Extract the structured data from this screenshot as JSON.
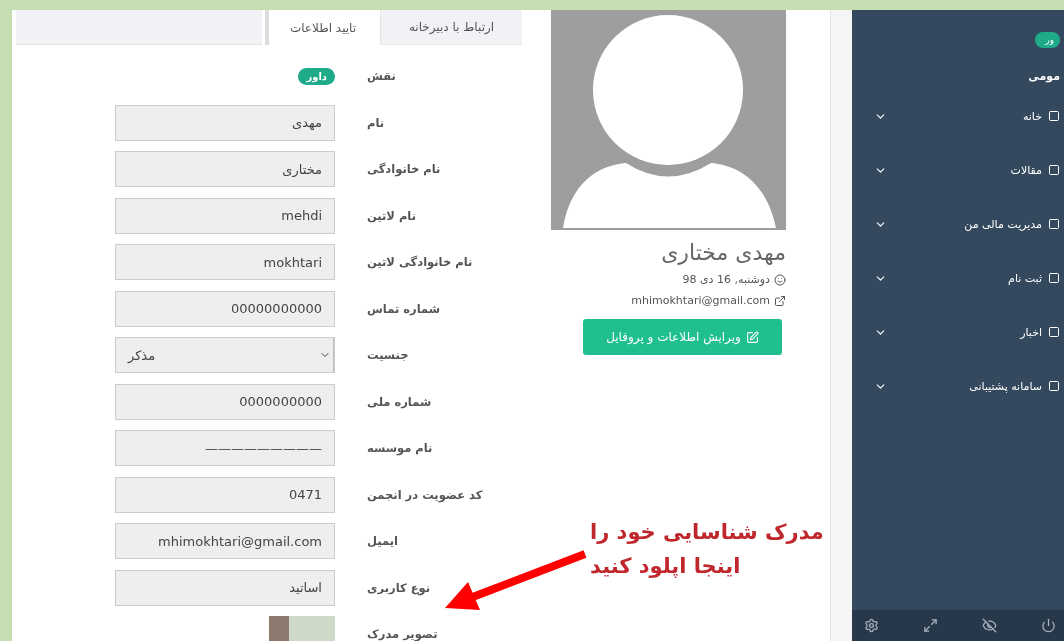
{
  "tabs": [
    {
      "label": "ارتباط با دبیرخانه",
      "selected": false
    },
    {
      "label": "تایید اطلاعات",
      "selected": true
    }
  ],
  "form": {
    "rows": [
      {
        "label": "نقش",
        "kind": "badge",
        "value": "داور"
      },
      {
        "label": "نام",
        "kind": "text",
        "value": "مهدی"
      },
      {
        "label": "نام خانوادگی",
        "kind": "text",
        "value": "مختاری"
      },
      {
        "label": "نام لاتین",
        "kind": "text",
        "value": "mehdi"
      },
      {
        "label": "نام خانوادگی لاتین",
        "kind": "text",
        "value": "mokhtari"
      },
      {
        "label": "شماره تماس",
        "kind": "text",
        "value": "00000000000"
      },
      {
        "label": "جنسیت",
        "kind": "select",
        "value": "مذکر"
      },
      {
        "label": "شماره ملی",
        "kind": "text",
        "value": "0000000000"
      },
      {
        "label": "نام موسسه",
        "kind": "text",
        "value": "—————————"
      },
      {
        "label": "کد عضویت در انجمن",
        "kind": "text",
        "value": "0471"
      },
      {
        "label": "ایمیل",
        "kind": "text",
        "value": "mhimokhtari@gmail.com"
      },
      {
        "label": "نوع کاربری",
        "kind": "text",
        "value": "اساتید"
      },
      {
        "label": "تصویر مدرک",
        "kind": "image"
      }
    ]
  },
  "profile": {
    "name": "مهدی مختاری",
    "date": "دوشنبه, 16 دی 98",
    "email": "mhimokhtari@gmail.com",
    "edit_button": "ویرایش اطلاعات و پروفایل"
  },
  "sidebar": {
    "badge": "ور",
    "section_title": "مومی",
    "items": [
      {
        "label": "خانه"
      },
      {
        "label": "مقالات"
      },
      {
        "label": "مدیریت مالی من"
      },
      {
        "label": "ثبت نام"
      },
      {
        "label": "اخبار"
      },
      {
        "label": "سامانه پشتیبانی"
      }
    ]
  },
  "annotation": {
    "lines": [
      "مدرک شناسایی خود را",
      "اینجا اپلود کنید"
    ]
  }
}
